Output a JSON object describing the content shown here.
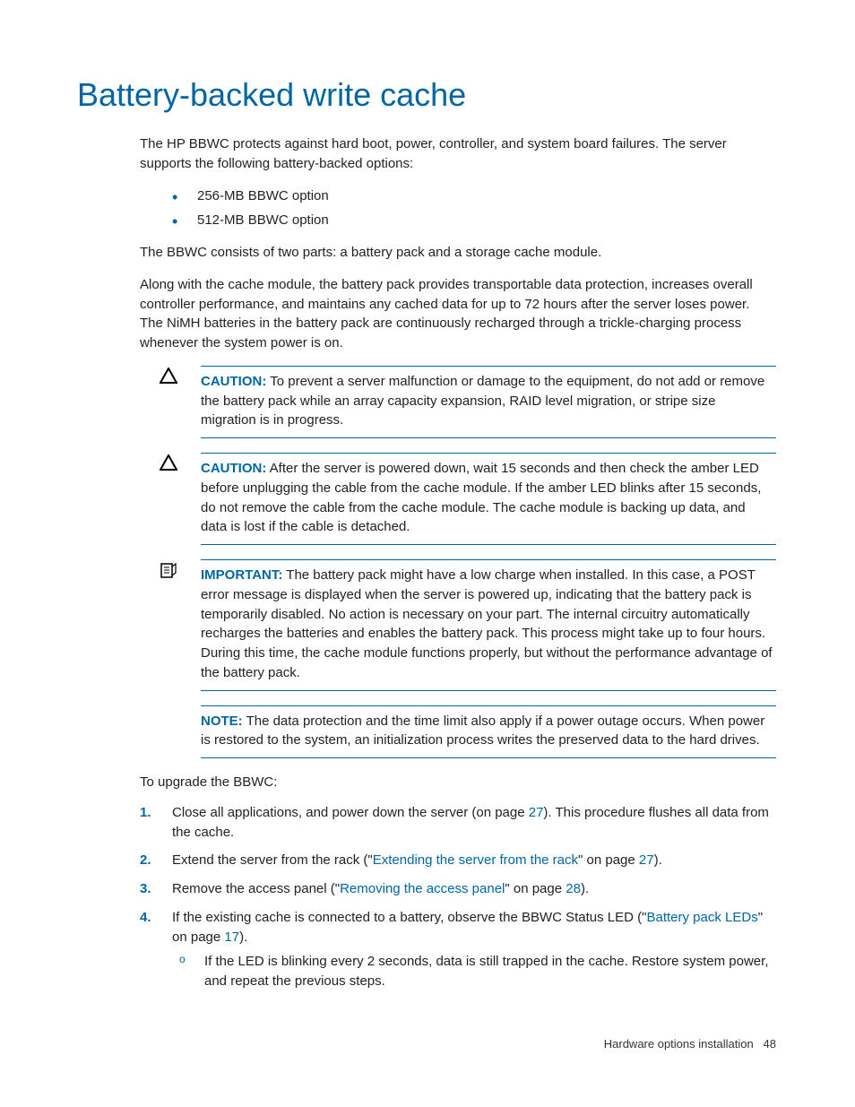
{
  "title": "Battery-backed write cache",
  "intro": "The HP BBWC protects against hard boot, power, controller, and system board failures. The server supports the following battery-backed options:",
  "bullets": [
    "256-MB BBWC option",
    "512-MB BBWC option"
  ],
  "para1": "The BBWC consists of two parts: a battery pack and a storage cache module.",
  "para2": "Along with the cache module, the battery pack provides transportable data protection, increases overall controller performance, and maintains any cached data for up to 72 hours after the server loses power. The NiMH batteries in the battery pack are continuously recharged through a trickle-charging process whenever the system power is on.",
  "callouts": {
    "caution1": {
      "label": "CAUTION:",
      "text": " To prevent a server malfunction or damage to the equipment, do not add or remove the battery pack while an array capacity expansion, RAID level migration, or stripe size migration is in progress."
    },
    "caution2": {
      "label": "CAUTION:",
      "text": " After the server is powered down, wait 15 seconds and then check the amber LED before unplugging the cable from the cache module. If the amber LED blinks after 15 seconds, do not remove the cable from the cache module. The cache module is backing up data, and data is lost if the cable is detached."
    },
    "important": {
      "label": "IMPORTANT:",
      "text": " The battery pack might have a low charge when installed. In this case, a POST error message is displayed when the server is powered up, indicating that the battery pack is temporarily disabled. No action is necessary on your part. The internal circuitry automatically recharges the batteries and enables the battery pack. This process might take up to four hours. During this time, the cache module functions properly, but without the performance advantage of the battery pack."
    },
    "note": {
      "label": "NOTE:",
      "text": " The data protection and the time limit also apply if a power outage occurs. When power is restored to the system, an initialization process writes the preserved data to the hard drives."
    }
  },
  "upgradeIntro": "To upgrade the BBWC:",
  "steps": {
    "s1a": "Close all applications, and power down the server (on page ",
    "s1link": "27",
    "s1b": "). This procedure flushes all data from the cache.",
    "s2a": "Extend the server from the rack (\"",
    "s2link1": "Extending the server from the rack",
    "s2b": "\" on page ",
    "s2link2": "27",
    "s2c": ").",
    "s3a": "Remove the access panel (\"",
    "s3link1": "Removing the access panel",
    "s3b": "\" on page ",
    "s3link2": "28",
    "s3c": ").",
    "s4a": "If the existing cache is connected to a battery, observe the BBWC Status LED (\"",
    "s4link1": "Battery pack LEDs",
    "s4b": "\" on page ",
    "s4link2": "17",
    "s4c": ").",
    "s4sub": "If the LED is blinking every 2 seconds, data is still trapped in the cache. Restore system power, and repeat the previous steps."
  },
  "footer": {
    "section": "Hardware options installation",
    "page": "48"
  }
}
